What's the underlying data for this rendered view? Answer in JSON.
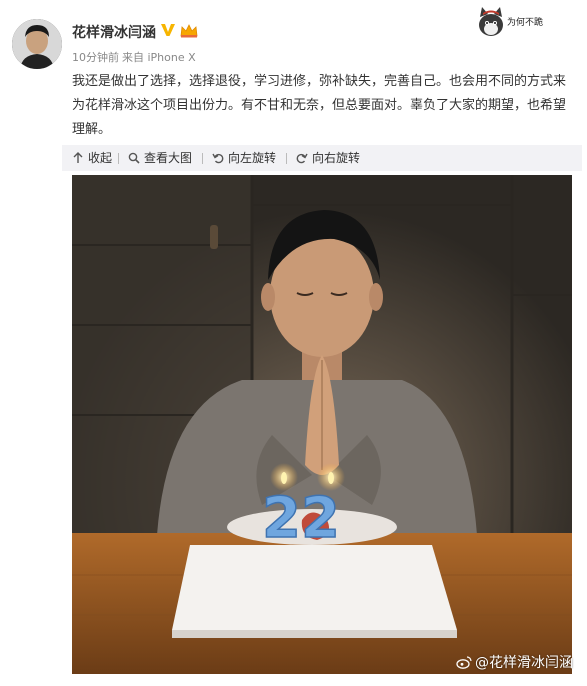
{
  "user": {
    "name": "花样滑冰闫涵",
    "time": "10分钟前",
    "source": "来自 iPhone X"
  },
  "post": {
    "text": "我还是做出了选择，选择退役，学习进修，弥补缺失，完善自己。也会用不同的方式来为花样滑冰这个项目出份力。有不甘和无奈，但总要面对。辜负了大家的期望，也希望理解。"
  },
  "toolbar": {
    "collapse_label": "收起",
    "view_large_label": "查看大图",
    "rotate_left_label": "向左旋转",
    "rotate_right_label": "向右旋转"
  },
  "sticker": {
    "text": "为何不跪"
  },
  "photo": {
    "candle_number": "22",
    "watermark": "@花样滑冰闫涵"
  },
  "colors": {
    "verified": "#f7b500",
    "toolbar_bg": "#f2f2f5",
    "meta_text": "#888888",
    "candle": "#6fa6df"
  }
}
